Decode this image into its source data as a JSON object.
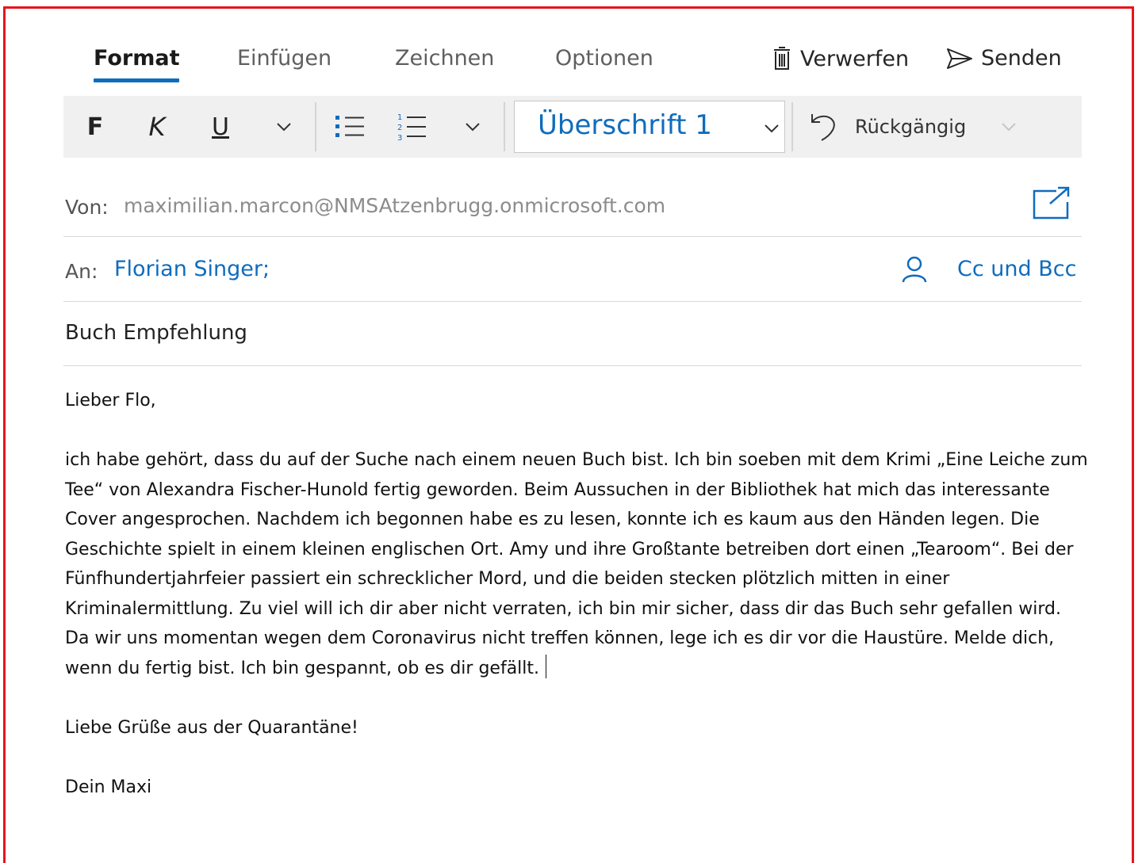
{
  "tabs": [
    {
      "label": "Format",
      "active": true
    },
    {
      "label": "Einfügen",
      "active": false
    },
    {
      "label": "Zeichnen",
      "active": false
    },
    {
      "label": "Optionen",
      "active": false
    }
  ],
  "actions": {
    "discard_label": "Verwerfen",
    "send_label": "Senden"
  },
  "toolbar": {
    "bold_glyph": "F",
    "italic_glyph": "K",
    "underline_glyph": "U",
    "style_value": "Überschrift 1",
    "undo_label": "Rückgängig"
  },
  "from": {
    "label": "Von:",
    "value": "maximilian.marcon@NMSAtzenbrugg.onmicrosoft.com"
  },
  "to": {
    "label": "An:",
    "recipient": "Florian Singer;",
    "cc_bcc_label": "Cc und Bcc"
  },
  "subject": "Buch Empfehlung",
  "body": {
    "greeting": "Lieber Flo,",
    "paragraph": "ich habe gehört, dass du auf der Suche nach einem neuen Buch bist. Ich bin soeben mit dem Krimi „Eine Leiche zum Tee“ von Alexandra Fischer-Hunold fertig geworden. Beim Aussuchen in der Bibliothek hat mich das interessante Cover angesprochen. Nachdem ich begonnen habe es zu lesen, konnte ich es kaum aus den Händen legen. Die Geschichte spielt in einem kleinen englischen Ort. Amy und ihre Großtante betreiben dort einen „Tearoom“. Bei der Fünfhundertjahrfeier passiert ein schrecklicher Mord, und die beiden stecken plötzlich mitten in einer Kriminalermittlung. Zu viel will ich dir aber nicht verraten, ich bin mir sicher, dass dir das Buch sehr gefallen wird. Da wir uns momentan wegen dem Coronavirus nicht treffen können, lege ich es dir vor die Haustüre. Melde dich, wenn du fertig bist. Ich bin gespannt, ob es dir gefällt.",
    "closing": "Liebe Grüße aus der Quarantäne!",
    "signature": "Dein Maxi"
  },
  "colors": {
    "accent": "#0f6cbd",
    "frame": "#e8141b",
    "toolbar_bg": "#f0f0f0"
  }
}
